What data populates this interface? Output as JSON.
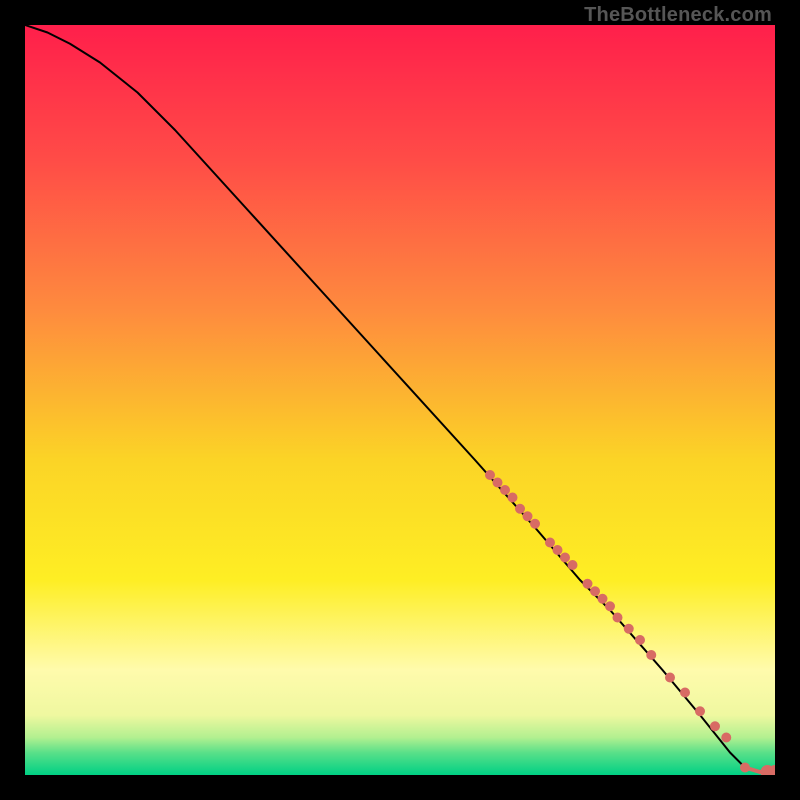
{
  "watermark": "TheBottleneck.com",
  "chart_data": {
    "type": "line",
    "title": "",
    "xlabel": "",
    "ylabel": "",
    "xlim": [
      0,
      100
    ],
    "ylim": [
      0,
      100
    ],
    "grid": false,
    "legend": false,
    "background_gradient": {
      "stops": [
        {
          "offset": 0,
          "color": "#ff1f4b"
        },
        {
          "offset": 18,
          "color": "#ff4c47"
        },
        {
          "offset": 38,
          "color": "#fe8b3e"
        },
        {
          "offset": 58,
          "color": "#fbd426"
        },
        {
          "offset": 74,
          "color": "#feee24"
        },
        {
          "offset": 86,
          "color": "#fffbac"
        },
        {
          "offset": 92,
          "color": "#eff8a0"
        },
        {
          "offset": 95,
          "color": "#b2f090"
        },
        {
          "offset": 97,
          "color": "#5ae089"
        },
        {
          "offset": 100,
          "color": "#00d084"
        }
      ]
    },
    "series": [
      {
        "name": "curve",
        "type": "line",
        "color": "#000000",
        "x": [
          0,
          3,
          6,
          10,
          15,
          20,
          30,
          40,
          50,
          60,
          68,
          74,
          78,
          85,
          90,
          94,
          96
        ],
        "y": [
          100,
          99,
          97.5,
          95,
          91,
          86,
          75,
          64,
          53,
          42,
          33,
          26,
          22,
          14,
          8,
          3,
          1
        ]
      },
      {
        "name": "tail",
        "type": "line",
        "color": "#d86b64",
        "x": [
          96,
          98,
          99,
          100
        ],
        "y": [
          1,
          0.4,
          0.4,
          0.4
        ]
      },
      {
        "name": "points",
        "type": "scatter",
        "color": "#d86b64",
        "radius_small": 5,
        "radius_large": 7,
        "x": [
          62,
          63,
          64,
          65,
          66,
          67,
          68,
          70,
          71,
          72,
          73,
          75,
          76,
          77,
          78,
          79,
          80.5,
          82,
          83.5,
          86,
          88,
          90,
          92,
          93.5,
          96,
          99,
          100
        ],
        "y": [
          40,
          39,
          38,
          37,
          35.5,
          34.5,
          33.5,
          31,
          30,
          29,
          28,
          25.5,
          24.5,
          23.5,
          22.5,
          21,
          19.5,
          18,
          16,
          13,
          11,
          8.5,
          6.5,
          5,
          1,
          0.4,
          0.4
        ]
      }
    ]
  }
}
